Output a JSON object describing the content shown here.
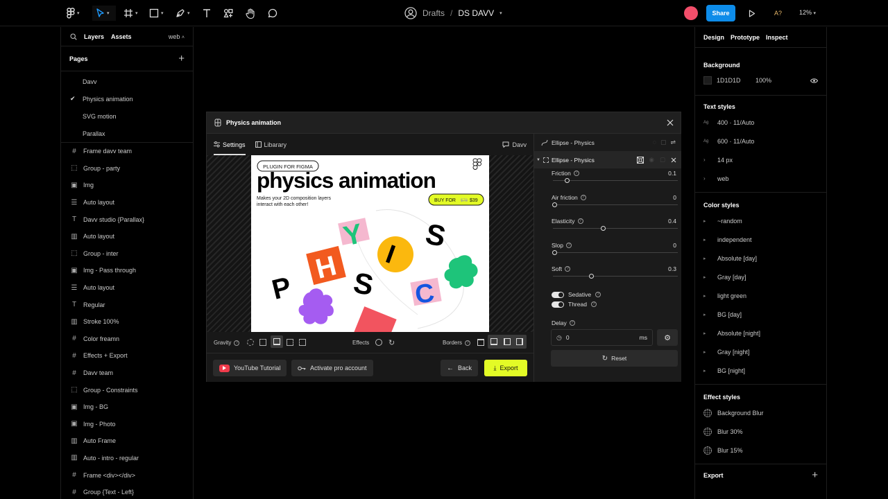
{
  "topbar": {
    "file_location": "Drafts",
    "separator": "/",
    "file_name": "DS DAVV",
    "share_label": "Share",
    "accessibility_label": "A?",
    "zoom": "12%",
    "colors": {
      "share": "#0d8ce9",
      "avatar": "#f24e6a"
    }
  },
  "left_panel": {
    "tabs": [
      "Layers",
      "Assets"
    ],
    "page_selector": "web",
    "pages_title": "Pages",
    "pages": [
      {
        "label": "Davv",
        "checked": false
      },
      {
        "label": "Physics animation",
        "checked": true
      },
      {
        "label": "SVG motion",
        "checked": false
      },
      {
        "label": "Parallax",
        "checked": false
      }
    ],
    "layers": [
      {
        "icon": "frame-icon",
        "label": "Frame davv team"
      },
      {
        "icon": "group-icon",
        "label": "Group - party"
      },
      {
        "icon": "image-icon",
        "label": "Img"
      },
      {
        "icon": "auto-layout-vertical-icon",
        "label": "Auto layout"
      },
      {
        "icon": "text-icon",
        "label": "Davv studio {Parallax}"
      },
      {
        "icon": "auto-layout-horizontal-icon",
        "label": "Auto layout"
      },
      {
        "icon": "group-icon",
        "label": "Group - inter"
      },
      {
        "icon": "image-icon",
        "label": "Img - Pass through"
      },
      {
        "icon": "auto-layout-vertical-icon",
        "label": "Auto layout"
      },
      {
        "icon": "text-icon",
        "label": "Regular"
      },
      {
        "icon": "auto-layout-horizontal-icon",
        "label": "Stroke 100%"
      },
      {
        "icon": "frame-icon",
        "label": "Color freamn"
      },
      {
        "icon": "frame-icon",
        "label": "Effects + Export"
      },
      {
        "icon": "frame-icon",
        "label": "Davv team"
      },
      {
        "icon": "group-icon",
        "label": "Group - Constraints"
      },
      {
        "icon": "image-icon",
        "label": "Img - BG"
      },
      {
        "icon": "image-icon",
        "label": "Img - Photo"
      },
      {
        "icon": "auto-layout-horizontal-icon",
        "label": "Auto Frame"
      },
      {
        "icon": "auto-layout-horizontal-icon",
        "label": "Auto - intro - regular"
      },
      {
        "icon": "frame-icon",
        "label": "Frame <div></div>"
      },
      {
        "icon": "frame-icon",
        "label": "Group {Text - Left}"
      }
    ]
  },
  "right_panel": {
    "tabs": [
      "Design",
      "Prototype",
      "Inspect"
    ],
    "background_title": "Background",
    "background_color": "1D1D1D",
    "background_opacity": "100%",
    "text_styles_title": "Text styles",
    "text_styles": [
      {
        "prefix": "Ag",
        "label": "400 · 11/Auto"
      },
      {
        "prefix": "Ag",
        "label": "600 · 11/Auto"
      },
      {
        "prefix": "›",
        "label": "14 px"
      },
      {
        "prefix": "›",
        "label": "web"
      }
    ],
    "color_styles_title": "Color styles",
    "color_styles": [
      "~random",
      "independent",
      "Absolute [day]",
      "Gray [day]",
      "light green",
      "BG [day]",
      "Absolute [night]",
      "Gray [night]",
      "BG [night]"
    ],
    "effect_styles_title": "Effect styles",
    "effect_styles": [
      "Background Blur",
      "Blur 30%",
      "Blur 15%"
    ],
    "export_title": "Export"
  },
  "dialog": {
    "title": "Physics animation",
    "tabs": [
      "Settings",
      "Libarary"
    ],
    "davv_label": "Davv",
    "preview": {
      "badge": "PLUGIN FOR FIGMA",
      "headline": "physics animation",
      "subtitle_line1": "Makes your 2D composition layers",
      "subtitle_line2": "interact with each other!",
      "buy_label": "BUY  FOR",
      "old_price": "$78",
      "new_price": "$39",
      "letters": [
        "P",
        "H",
        "Y",
        "S",
        "I",
        "C",
        "S"
      ]
    },
    "controls": {
      "gravity": "Gravity",
      "effects": "Effects",
      "borders": "Borders"
    },
    "youtube_label": "YouTube Tutorial",
    "activate_label": "Activate pro account",
    "back_label": "Back",
    "export_label": "Export",
    "layer_header": "Ellipse - Physics",
    "layer_selected": "Ellipse - Physics",
    "props": [
      {
        "label": "Friction",
        "value": "0.1",
        "fraction": 0.1
      },
      {
        "label": "Air friction",
        "value": "0",
        "fraction": 0.0
      },
      {
        "label": "Elasticity",
        "value": "0.4",
        "fraction": 0.4
      },
      {
        "label": "Slop",
        "value": "0",
        "fraction": 0.0
      },
      {
        "label": "Soft",
        "value": "0.3",
        "fraction": 0.3
      }
    ],
    "toggles": [
      {
        "label": "Sedative",
        "on": true
      },
      {
        "label": "Thread",
        "on": true
      }
    ],
    "delay_label": "Delay",
    "delay_value": "0",
    "delay_unit": "ms",
    "reset_label": "Reset",
    "colors": {
      "export": "#e3fb26",
      "youtube": "#f03b4b"
    }
  }
}
